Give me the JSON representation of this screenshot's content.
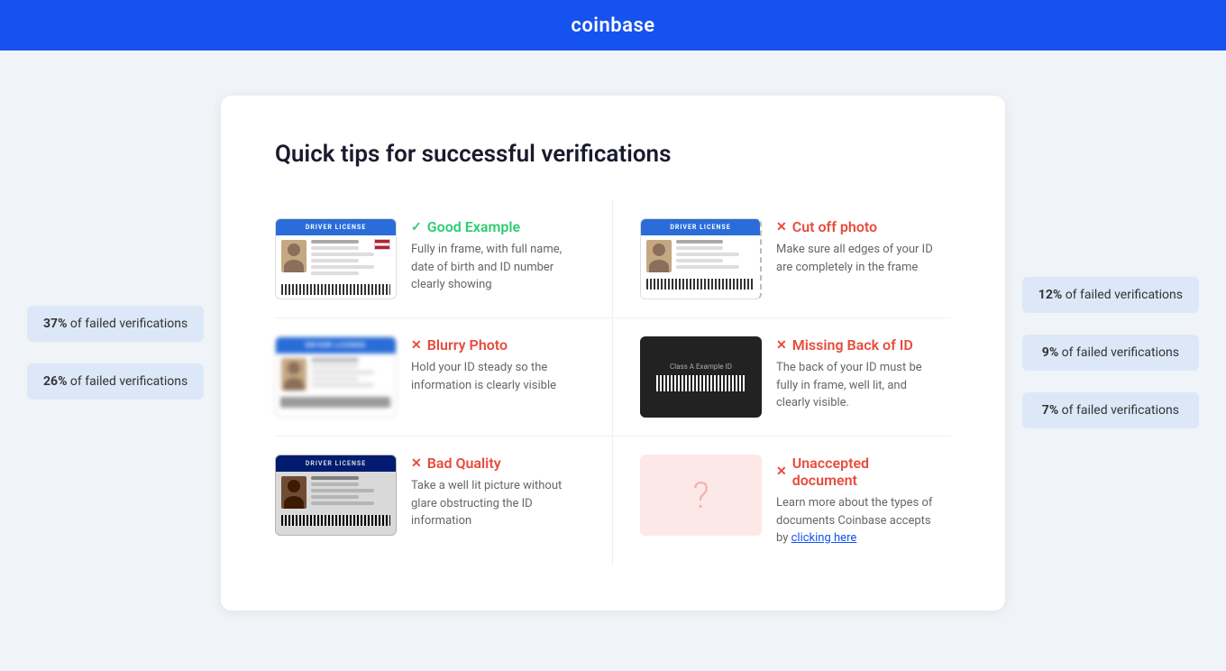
{
  "header": {
    "logo": "coinbase"
  },
  "left_sidebar": {
    "stats": [
      {
        "percent": "37%",
        "label": "of failed verifications"
      },
      {
        "percent": "26%",
        "label": "of failed verifications"
      }
    ]
  },
  "right_sidebar": {
    "stats": [
      {
        "percent": "12%",
        "label": "of failed verifications"
      },
      {
        "percent": "9%",
        "label": "of failed verifications"
      },
      {
        "percent": "7%",
        "label": "of failed verifications"
      }
    ]
  },
  "main_card": {
    "title": "Quick tips for successful verifications",
    "tips": [
      {
        "id": "good-example",
        "type": "good",
        "icon": "✓",
        "name": "Good Example",
        "desc": "Fully in frame, with full name, date of birth and ID number clearly showing",
        "visual": "good"
      },
      {
        "id": "cut-off-photo",
        "type": "bad",
        "icon": "✕",
        "name": "Cut off photo",
        "desc": "Make sure all edges of your ID are completely in the frame",
        "visual": "cutoff"
      },
      {
        "id": "blurry-photo",
        "type": "bad",
        "icon": "✕",
        "name": "Blurry Photo",
        "desc": "Hold your ID steady so the information is clearly visible",
        "visual": "blurry"
      },
      {
        "id": "missing-back",
        "type": "bad",
        "icon": "✕",
        "name": "Missing Back of ID",
        "desc": "The back of your ID must be fully in frame, well lit, and clearly visible.",
        "visual": "back"
      },
      {
        "id": "bad-quality",
        "type": "bad",
        "icon": "✕",
        "name": "Bad Quality",
        "desc": "Take a well lit picture without glare obstructing the ID information",
        "visual": "bad"
      },
      {
        "id": "unaccepted-document",
        "type": "bad",
        "icon": "✕",
        "name": "Unaccepted document",
        "desc": "Learn more about the types of documents Coinbase accepts by",
        "link_text": "clicking here",
        "visual": "unaccepted"
      }
    ]
  }
}
